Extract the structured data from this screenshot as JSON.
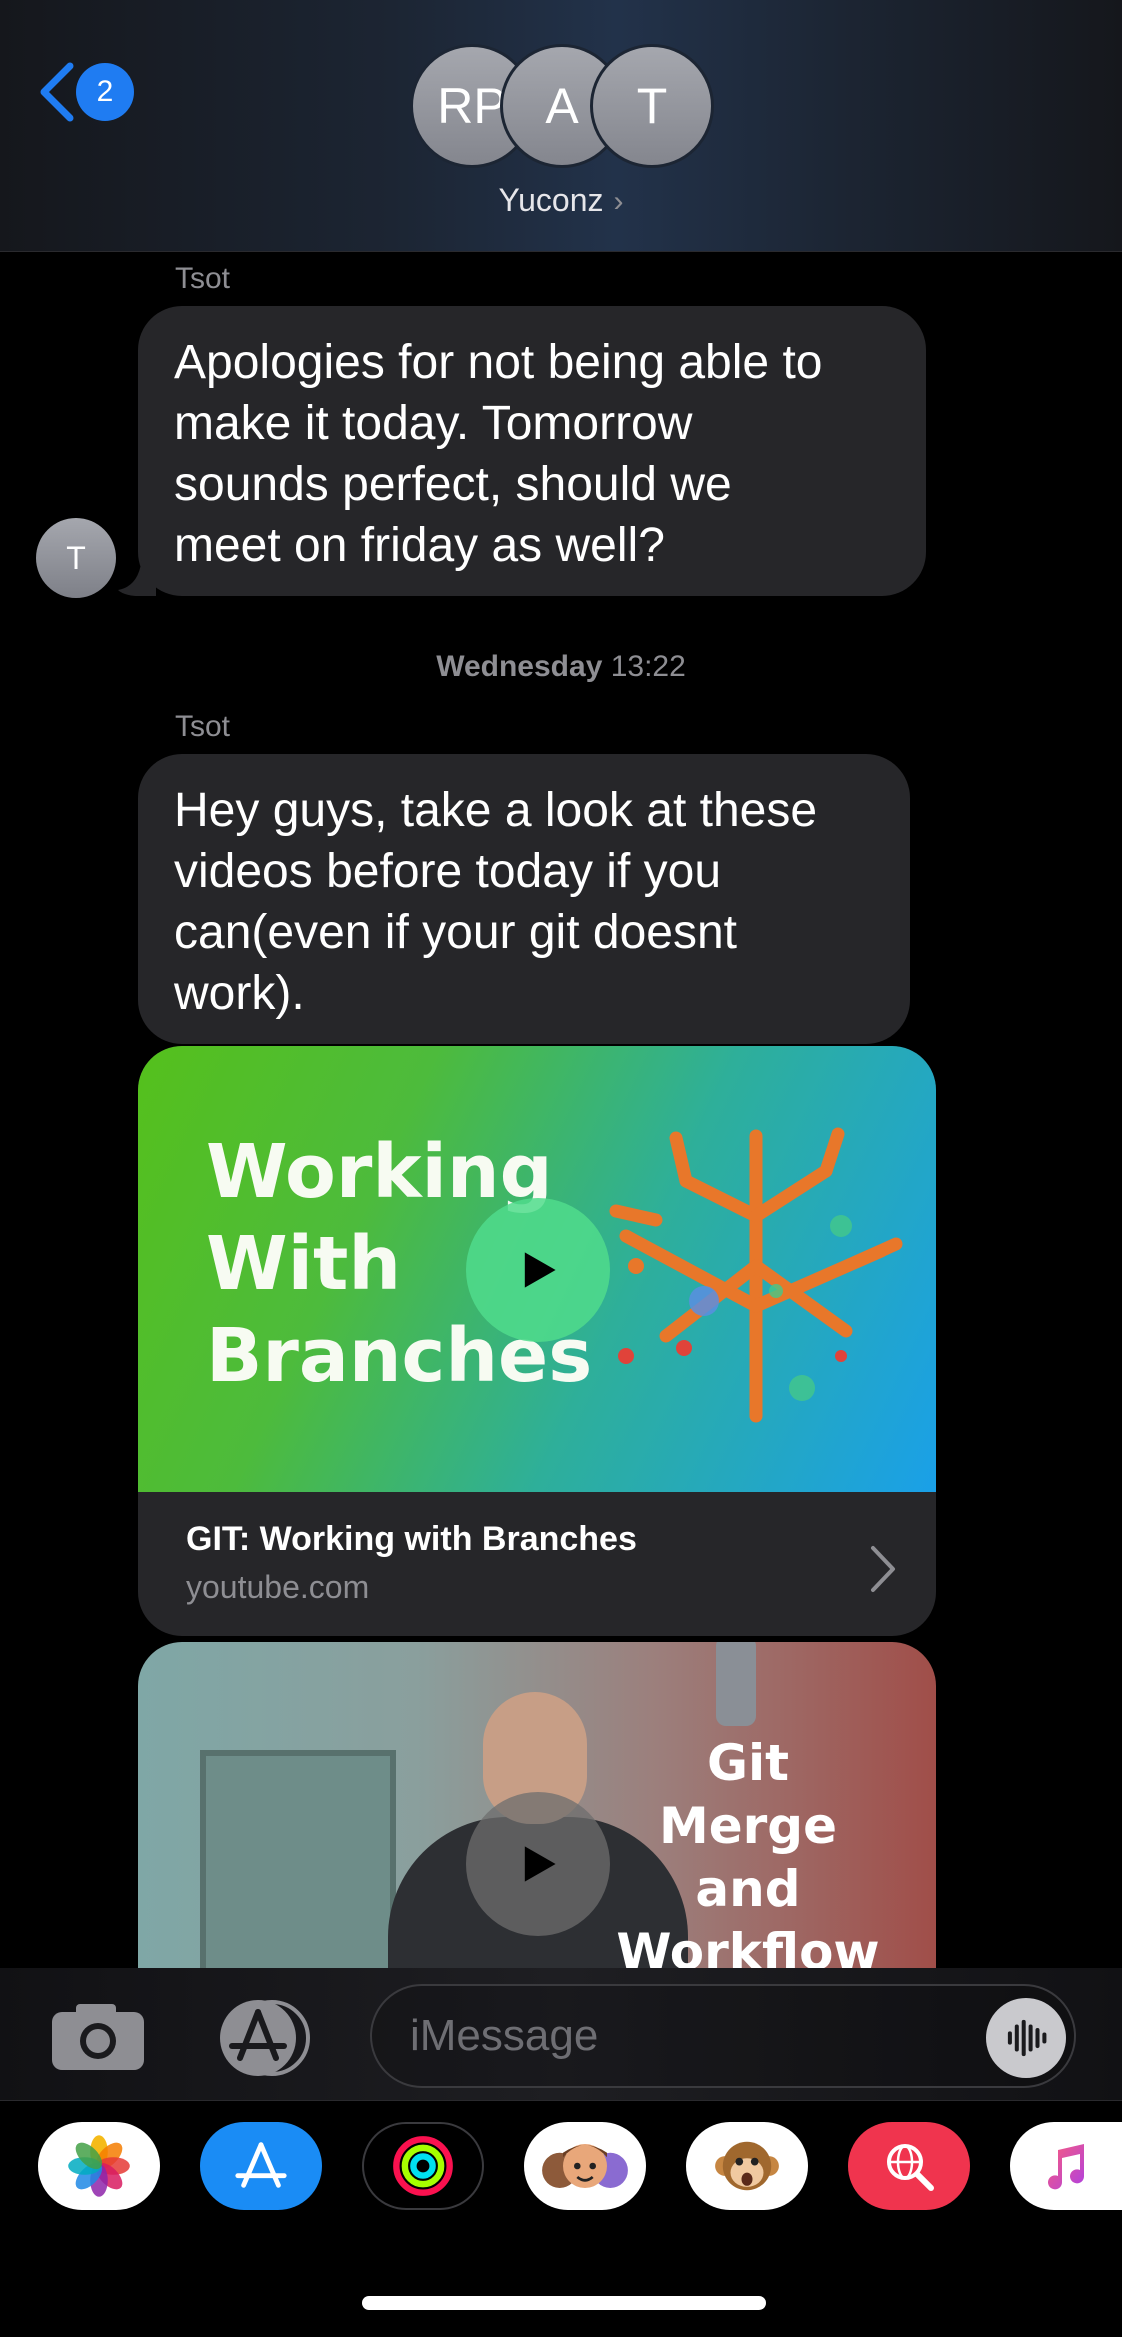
{
  "header": {
    "back_count": "2",
    "avatars": [
      "RP",
      "A",
      "T"
    ],
    "group_name": "Yuconz",
    "chevron": "›"
  },
  "messages": [
    {
      "sender": "Tsot",
      "text_lines": [
        "Apologies for not being able to",
        "make it today. Tomorrow",
        "sounds perfect, should we",
        "meet on friday as well?"
      ],
      "avatar": "T"
    }
  ],
  "timestamp": {
    "day": "Wednesday",
    "time": "13:22"
  },
  "message2": {
    "sender": "Tsot",
    "text_lines": [
      "Hey guys, take a look at these",
      "videos before today if you",
      "can(even if your git doesnt",
      "work)."
    ]
  },
  "link_preview_1": {
    "thumb_title_lines": [
      "Working",
      "With",
      "Branches"
    ],
    "title": "GIT: Working with Branches",
    "host": "youtube.com"
  },
  "link_preview_2": {
    "thumb_title_lines": [
      "Git",
      "Merge",
      "and",
      "Workflow"
    ]
  },
  "input": {
    "placeholder": "iMessage"
  },
  "app_drawer": {
    "apps": [
      "photos-icon",
      "app-store-icon",
      "activity-icon",
      "memoji-icon",
      "animoji-icon",
      "web-search-icon",
      "music-icon"
    ]
  },
  "colors": {
    "accent": "#1f7cf2",
    "bubble": "#262629",
    "secondary_text": "#8e8e93"
  }
}
